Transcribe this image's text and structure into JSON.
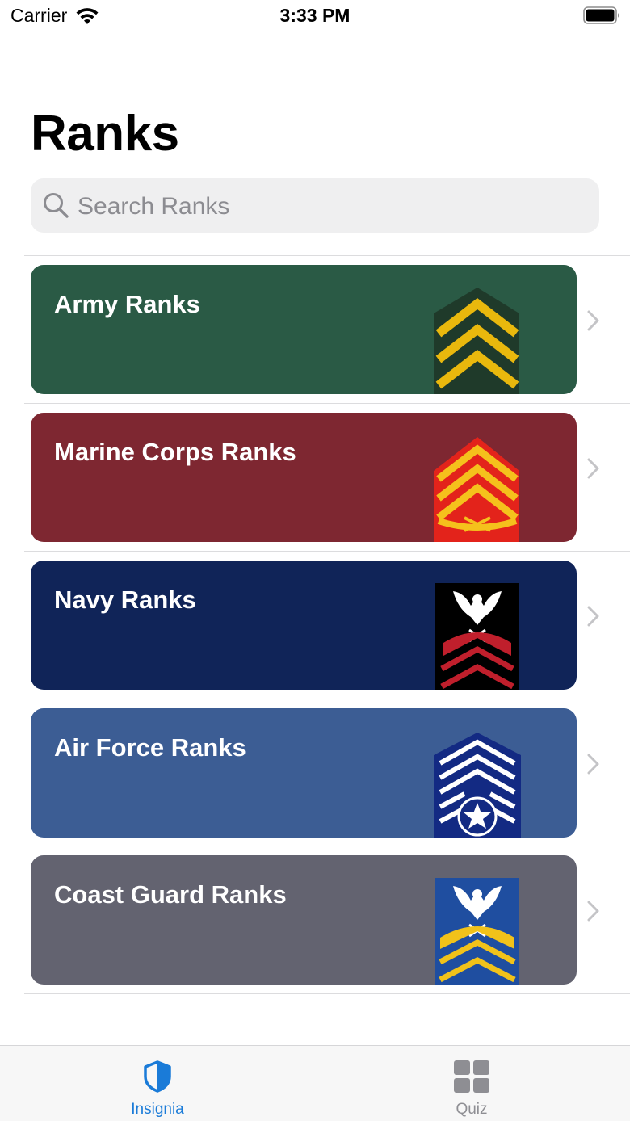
{
  "status_bar": {
    "carrier": "Carrier",
    "time": "3:33 PM"
  },
  "header": {
    "title": "Ranks"
  },
  "search": {
    "placeholder": "Search Ranks",
    "value": ""
  },
  "colors": {
    "army": "#2a5a45",
    "marine": "#7e2731",
    "navy": "#102458",
    "air_force": "#3c5d94",
    "coast_guard": "#636370",
    "tab_active": "#1a7bd8",
    "tab_inactive": "#8e8e93"
  },
  "ranks": [
    {
      "label": "Army Ranks",
      "insignia": "army-sergeant-chevron-icon"
    },
    {
      "label": "Marine Corps Ranks",
      "insignia": "marine-gunnery-sergeant-chevron-icon"
    },
    {
      "label": "Navy Ranks",
      "insignia": "navy-chief-petty-officer-eagle-icon"
    },
    {
      "label": "Air Force Ranks",
      "insignia": "air-force-master-sergeant-star-icon"
    },
    {
      "label": "Coast Guard Ranks",
      "insignia": "coast-guard-chief-eagle-icon"
    }
  ],
  "tabs": [
    {
      "label": "Insignia",
      "icon": "shield-icon",
      "active": true
    },
    {
      "label": "Quiz",
      "icon": "grid-icon",
      "active": false
    }
  ]
}
